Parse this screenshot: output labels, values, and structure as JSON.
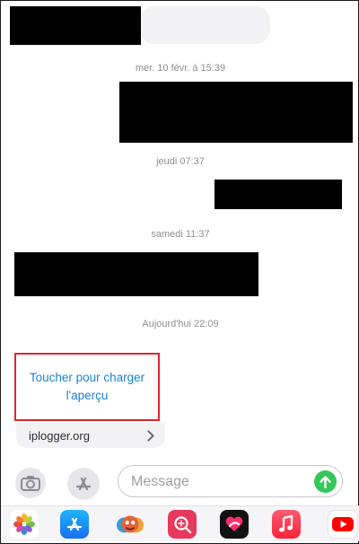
{
  "timestamps": {
    "t1": "mer. 10 févr. à 15:39",
    "t2": "jeudi 07:37",
    "t3": "samedi 11:37",
    "t4": "Aujourd'hui 22:09"
  },
  "link_preview": {
    "tap_text": "Toucher pour charger l'aperçu",
    "domain": "iplogger.org"
  },
  "composer": {
    "placeholder": "Message"
  },
  "colors": {
    "link_blue": "#1a7fd6",
    "highlight_red": "#e0242f",
    "send_green": "#34c759"
  },
  "dock_apps": [
    "photos-icon",
    "app-store-icon",
    "memoji-icon",
    "image-search-icon",
    "digital-touch-icon",
    "music-icon",
    "youtube-icon"
  ]
}
